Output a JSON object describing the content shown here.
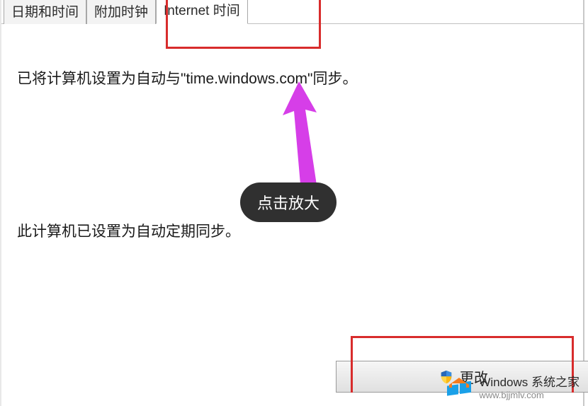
{
  "tabs": {
    "tab1": "日期和时间",
    "tab2": "附加时钟",
    "tab3": "Internet 时间"
  },
  "content": {
    "sync_status": "已将计算机设置为自动与\"time.windows.com\"同步。",
    "auto_sync": "此计算机已设置为自动定期同步。"
  },
  "tooltip": "点击放大",
  "button": {
    "change_label": "更改"
  },
  "watermark": {
    "line1": "Windows 系统之家",
    "line2": "www.bjjmlv.com"
  }
}
